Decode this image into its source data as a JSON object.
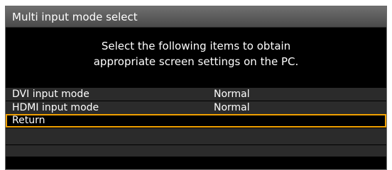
{
  "window": {
    "title": "Multi input mode select"
  },
  "message": {
    "line1": "Select the following items to obtain",
    "line2": "appropriate screen settings on the PC."
  },
  "menu": {
    "items": [
      {
        "label": "DVI input mode",
        "value": "Normal"
      },
      {
        "label": "HDMI input mode",
        "value": "Normal"
      },
      {
        "label": "Return",
        "value": ""
      }
    ],
    "selected_index": 2
  },
  "colors": {
    "selection_border": "#f0a000",
    "title_bar": "#5a5a5a",
    "row_background": "#2b2b2b",
    "background": "#000000"
  }
}
